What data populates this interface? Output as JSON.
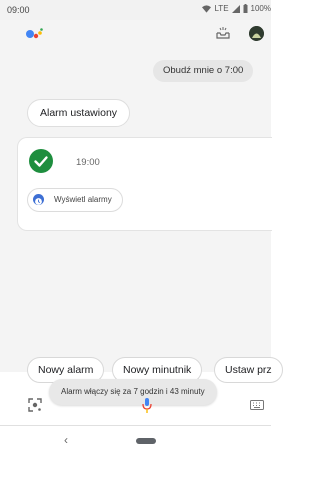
{
  "status_bar": {
    "time": "09:00",
    "network": "LTE",
    "battery": "100%"
  },
  "conversation": {
    "user_query": "Obudź mnie o 7:00",
    "assistant_reply": "Alarm ustawiony",
    "alarm_card": {
      "time": "19:00",
      "view_alarms_label": "Wyświetl alarmy"
    }
  },
  "suggestions": [
    "Nowy alarm",
    "Nowy minutnik",
    "Ustaw prz"
  ],
  "toast": "Alarm włączy się za 7 godzin i 43 minuty",
  "nav": {
    "back_icon": "‹"
  },
  "colors": {
    "check_green": "#1e8e3e",
    "clock_blue": "#3d6fd4",
    "google_blue": "#4285f4",
    "google_red": "#ea4335",
    "google_yellow": "#fbbc05",
    "google_green": "#34a853"
  }
}
